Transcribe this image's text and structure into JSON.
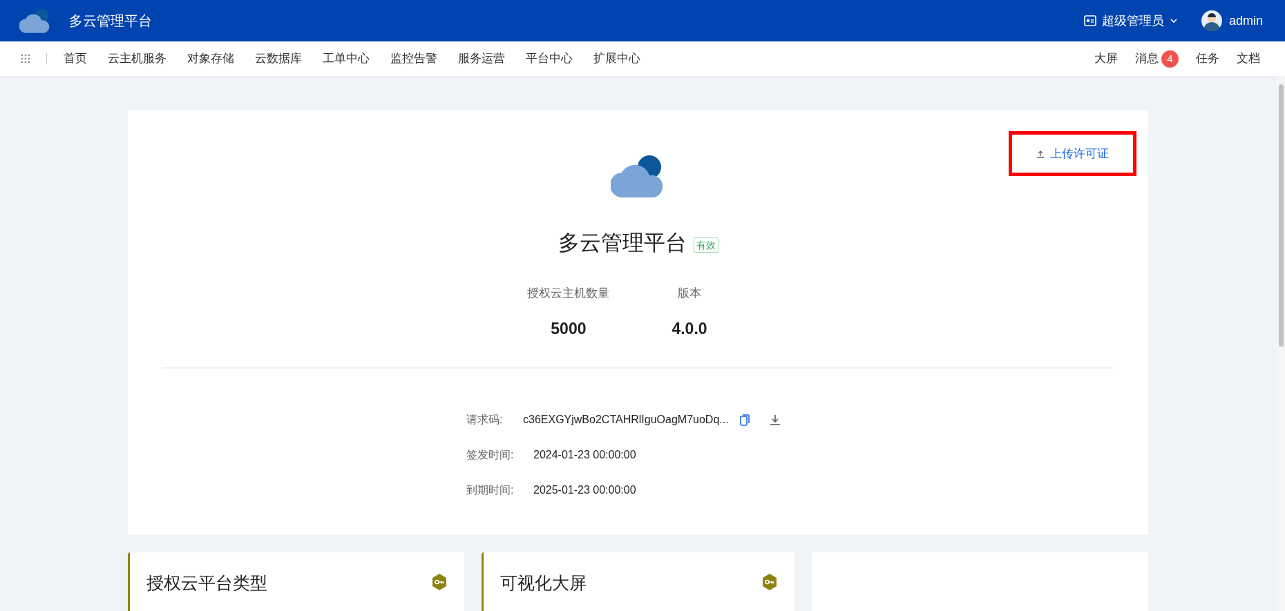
{
  "header": {
    "brand": "多云管理平台",
    "role": "超级管理员",
    "user": "admin"
  },
  "nav": {
    "items": [
      {
        "label": "首页",
        "selected": false
      },
      {
        "label": "云主机服务",
        "selected": false
      },
      {
        "label": "对象存储",
        "selected": false
      },
      {
        "label": "云数据库",
        "selected": false
      },
      {
        "label": "工单中心",
        "selected": false
      },
      {
        "label": "监控告警",
        "selected": false
      },
      {
        "label": "服务运营",
        "selected": false
      },
      {
        "label": "平台中心",
        "selected": false
      },
      {
        "label": "扩展中心",
        "selected": false
      }
    ],
    "right": [
      {
        "label": "大屏"
      },
      {
        "label": "消息",
        "badge": "4"
      },
      {
        "label": "任务"
      },
      {
        "label": "文档"
      }
    ]
  },
  "license": {
    "upload_button": {
      "label": "上传许可证",
      "highlighted": true
    },
    "title": "多云管理平台",
    "status": "有效",
    "stats": [
      {
        "label": "授权云主机数量",
        "value": "5000"
      },
      {
        "label": "版本",
        "value": "4.0.0"
      }
    ],
    "details": [
      {
        "kind": "code",
        "label": "请求码:",
        "value": "c36EXGYjwBo2CTAHRlIguOagM7uoDq..."
      },
      {
        "kind": "text",
        "label": "签发时间:",
        "value": "2024-01-23 00:00:00"
      },
      {
        "kind": "text",
        "label": "到期时间:",
        "value": "2025-01-23 00:00:00"
      }
    ]
  },
  "cards": [
    {
      "title": "授权云平台类型",
      "locked": true
    },
    {
      "title": "可视化大屏",
      "locked": true
    },
    {
      "locked": false
    }
  ]
}
